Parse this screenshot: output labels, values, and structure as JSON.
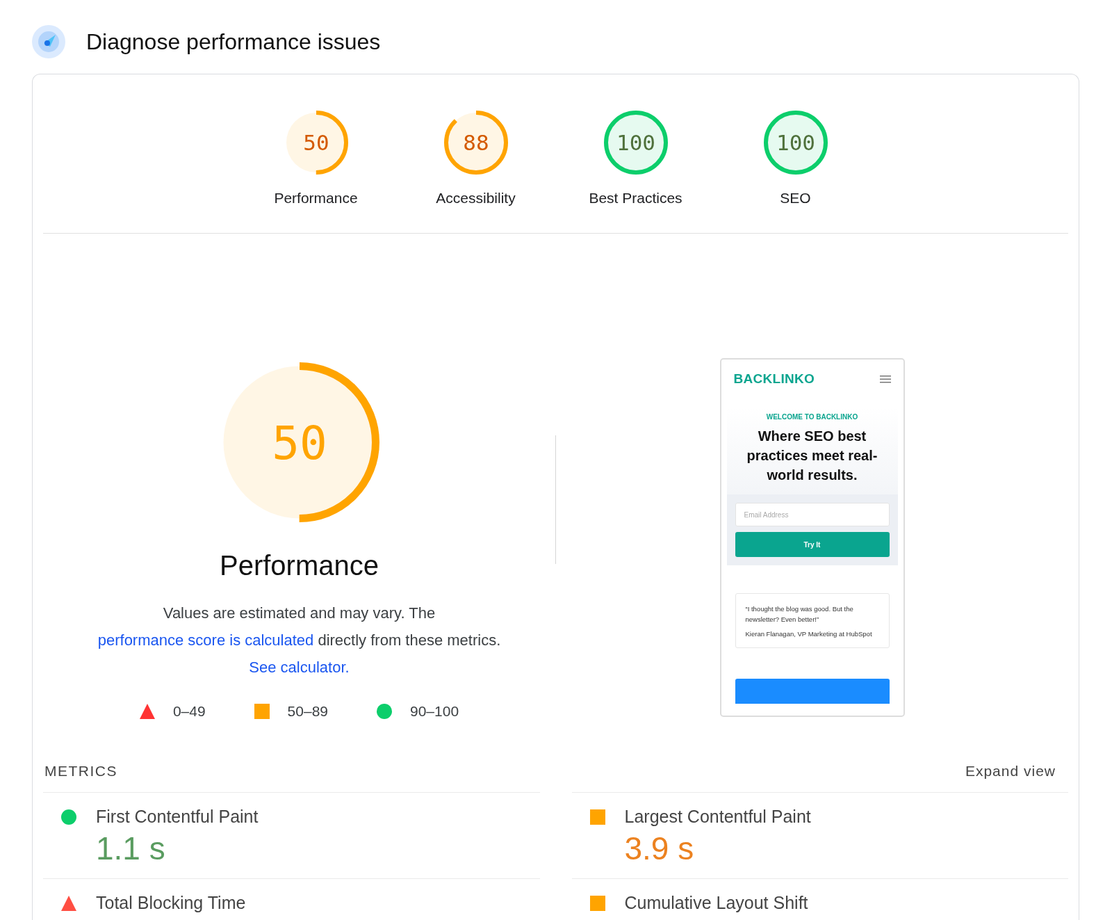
{
  "header": {
    "title": "Diagnose performance issues"
  },
  "categories": [
    {
      "score": "50",
      "label": "Performance",
      "level": 0.5,
      "color": "#ffa400"
    },
    {
      "score": "88",
      "label": "Accessibility",
      "level": 0.88,
      "color": "#ffa400"
    },
    {
      "score": "100",
      "label": "Best Practices",
      "level": 1,
      "color": "#0cce6b"
    },
    {
      "score": "100",
      "label": "SEO",
      "level": 1,
      "color": "#0cce6b"
    }
  ],
  "performance": {
    "score": "50",
    "level": 0.5,
    "color": "#ffa400",
    "title": "Performance",
    "description": [
      {
        "text": "Values are estimated and may vary. The ",
        "link": false
      },
      {
        "text": "performance score is calculated",
        "link": true
      },
      {
        "text": " directly from these metrics. ",
        "link": false
      },
      {
        "text": "See calculator.",
        "link": true
      }
    ]
  },
  "legend": [
    {
      "kind": "triangle",
      "label": "0–49"
    },
    {
      "kind": "square",
      "label": "50–89"
    },
    {
      "kind": "circle",
      "label": "90–100"
    }
  ],
  "screenshot": {
    "logo": "BACKLINKO",
    "eyebrow": "WELCOME TO BACKLINKO",
    "headline": "Where SEO best practices meet real-world results.",
    "email_placeholder": "Email Address",
    "button": "Try It",
    "quote": "“I thought the blog was good. But the newsletter? Even better!”",
    "author": "Kieran Flanagan, VP Marketing at HubSpot"
  },
  "metrics": {
    "title": "METRICS",
    "expand": "Expand view",
    "items": [
      {
        "name": "First Contentful Paint",
        "value": "1.1 s",
        "kind": "circle",
        "color": "#0cce6b"
      },
      {
        "name": "Largest Contentful Paint",
        "value": "3.9 s",
        "kind": "square",
        "color": "#ffa400"
      },
      {
        "name": "Total Blocking Time",
        "kind": "triangle",
        "color": "#ff4e42"
      },
      {
        "name": "Cumulative Layout Shift",
        "kind": "square",
        "color": "#ffa400"
      }
    ]
  }
}
